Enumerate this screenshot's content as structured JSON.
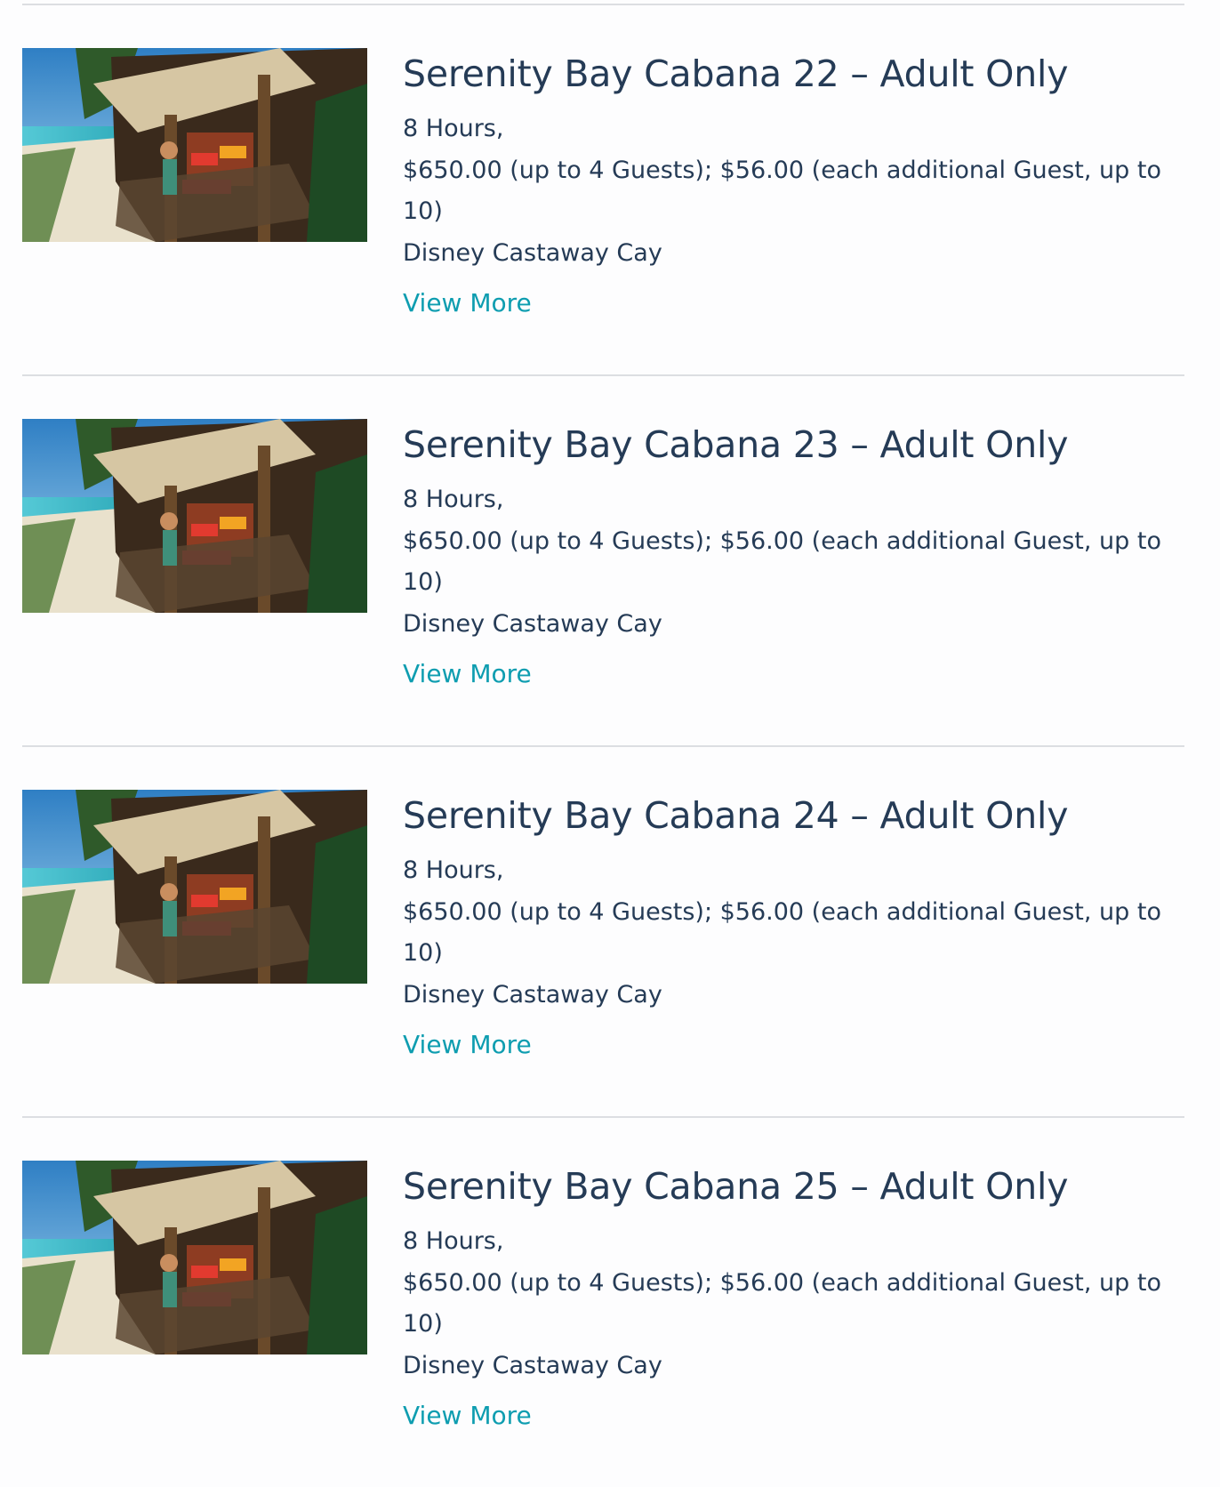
{
  "listings": [
    {
      "title": "Serenity Bay Cabana 22 – Adult Only",
      "duration": "8 Hours,",
      "price": "$650.00 (up to 4 Guests); $56.00 (each additional Guest, up to 10)",
      "location": "Disney Castaway Cay",
      "link": "View More"
    },
    {
      "title": "Serenity Bay Cabana 23 – Adult Only",
      "duration": "8 Hours,",
      "price": "$650.00 (up to 4 Guests); $56.00 (each additional Guest, up to 10)",
      "location": "Disney Castaway Cay",
      "link": "View More"
    },
    {
      "title": "Serenity Bay Cabana 24 – Adult Only",
      "duration": "8 Hours,",
      "price": "$650.00 (up to 4 Guests); $56.00 (each additional Guest, up to 10)",
      "location": "Disney Castaway Cay",
      "link": "View More"
    },
    {
      "title": "Serenity Bay Cabana 25 – Adult Only",
      "duration": "8 Hours,",
      "price": "$650.00 (up to 4 Guests); $56.00 (each additional Guest, up to 10)",
      "location": "Disney Castaway Cay",
      "link": "View More"
    }
  ],
  "colors": {
    "text": "#253b56",
    "link": "#0e9db0",
    "divider": "#dcdee2"
  }
}
